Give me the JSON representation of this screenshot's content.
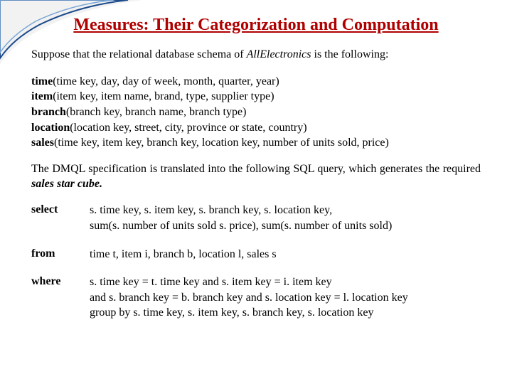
{
  "title": "Measures: Their Categorization and Computation",
  "intro_prefix": "Suppose that the relational database schema of ",
  "intro_em": "AllElectronics",
  "intro_suffix": " is the following:",
  "schemas": [
    {
      "rel": "time",
      "cols": "(time key, day, day of week, month, quarter, year)"
    },
    {
      "rel": "item",
      "cols": "(item key, item name, brand, type, supplier type)"
    },
    {
      "rel": "branch",
      "cols": "(branch key, branch name, branch type)"
    },
    {
      "rel": "location",
      "cols": "(location key, street, city, province or state, country)"
    },
    {
      "rel": "sales",
      "cols": "(time key, item key, branch key, location key, number of units sold, price)"
    }
  ],
  "para2_prefix": "The DMQL specification  is translated into the following SQL query, which generates the required ",
  "para2_em": "sales star cube.",
  "sql": {
    "select_kw": "select",
    "select_body_l1": "s. time key, s. item key, s. branch key, s. location key,",
    "select_body_l2": "sum(s. number of units sold  s. price), sum(s. number of units sold)",
    "from_kw": "from",
    "from_body": "time t, item i, branch b, location l, sales s",
    "where_kw": "where",
    "where_l1": "s. time key = t. time key and s. item key = i. item key",
    "where_l2": "and s. branch key = b. branch key and s. location key = l. location key",
    "where_l3": "group by s. time key, s. item key, s. branch key, s. location key"
  }
}
